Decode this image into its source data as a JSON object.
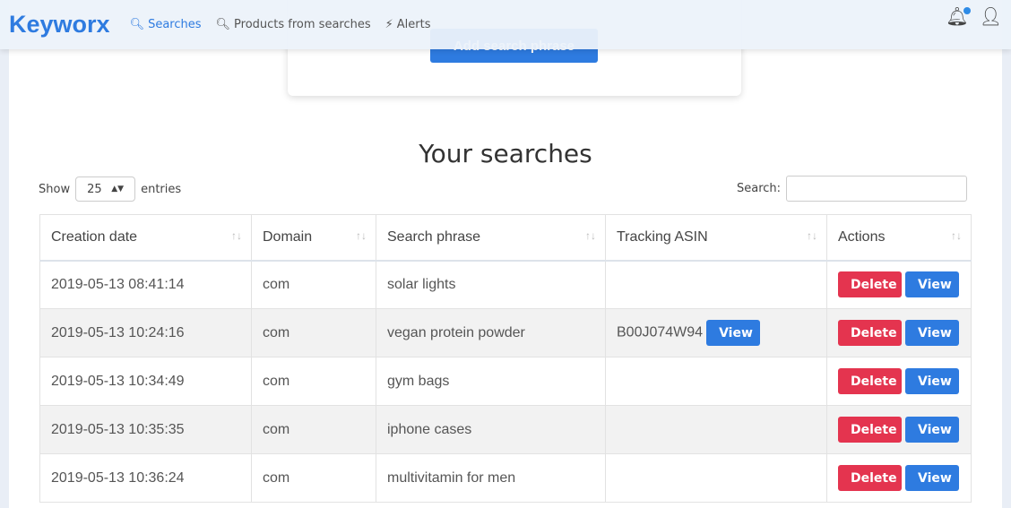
{
  "nav": {
    "logo": "Keyworx",
    "links": [
      {
        "label": "Searches",
        "icon": "search-icon"
      },
      {
        "label": "Products from searches",
        "icon": "search-icon"
      },
      {
        "label": "Alerts",
        "icon": "bolt-icon"
      }
    ],
    "notification_dot_color": "#2e8be6"
  },
  "card": {
    "add_button": "Add search phrase"
  },
  "main": {
    "title": "Your searches",
    "show_label": "Show",
    "entries_value": "25",
    "entries_label": "entries",
    "search_label": "Search:",
    "search_value": ""
  },
  "table": {
    "headers": [
      "Creation date",
      "Domain",
      "Search phrase",
      "Tracking ASIN",
      "Actions"
    ],
    "rows": [
      {
        "date": "2019-05-13 08:41:14",
        "domain": "com",
        "phrase": "solar lights",
        "asin": ""
      },
      {
        "date": "2019-05-13 10:24:16",
        "domain": "com",
        "phrase": "vegan protein powder",
        "asin": "B00J074W94"
      },
      {
        "date": "2019-05-13 10:34:49",
        "domain": "com",
        "phrase": "gym bags",
        "asin": ""
      },
      {
        "date": "2019-05-13 10:35:35",
        "domain": "com",
        "phrase": "iphone cases",
        "asin": ""
      },
      {
        "date": "2019-05-13 10:36:24",
        "domain": "com",
        "phrase": "multivitamin for men",
        "asin": ""
      }
    ],
    "delete_label": "Delete",
    "view_label": "View"
  },
  "colors": {
    "primary": "#2e7be0",
    "danger": "#e4344f"
  }
}
